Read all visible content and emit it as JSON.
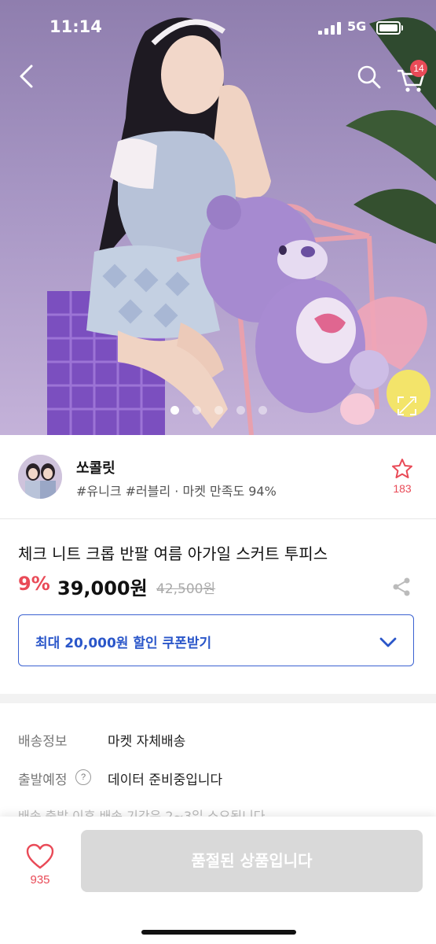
{
  "status_bar": {
    "time": "11:14",
    "network": "5G"
  },
  "header": {
    "cart_count": "14"
  },
  "gallery": {
    "total_images": 5,
    "active_index": 0
  },
  "seller": {
    "name": "쏘콜릿",
    "tags": "#유니크 #러블리 · 마켓 만족도 94%",
    "favorite_count": "183"
  },
  "product": {
    "title": "체크 니트 크롭 반팔 여름 아가일 스커트 투피스",
    "discount": "9%",
    "price": "39,000원",
    "original_price": "42,500원",
    "coupon_label": "최대 20,000원 할인 쿠폰받기"
  },
  "shipping": {
    "delivery_label": "배송정보",
    "delivery_value": "마켓 자체배송",
    "dispatch_label": "출발예정",
    "dispatch_help": "?",
    "dispatch_value": "데이터 준비중입니다",
    "note": "배송 출발 이후 배송 기간은 2~3일 소요됩니다"
  },
  "bottom_bar": {
    "like_count": "935",
    "soldout_label": "품절된 상품입니다"
  },
  "colors": {
    "accent_red": "#e94a57",
    "coupon_blue": "#2a56c9",
    "disabled_gray": "#d9d9d9"
  },
  "icons": [
    "back-icon",
    "search-icon",
    "cart-icon",
    "expand-icon",
    "star-icon",
    "share-icon",
    "chevron-down-icon",
    "heart-icon"
  ]
}
